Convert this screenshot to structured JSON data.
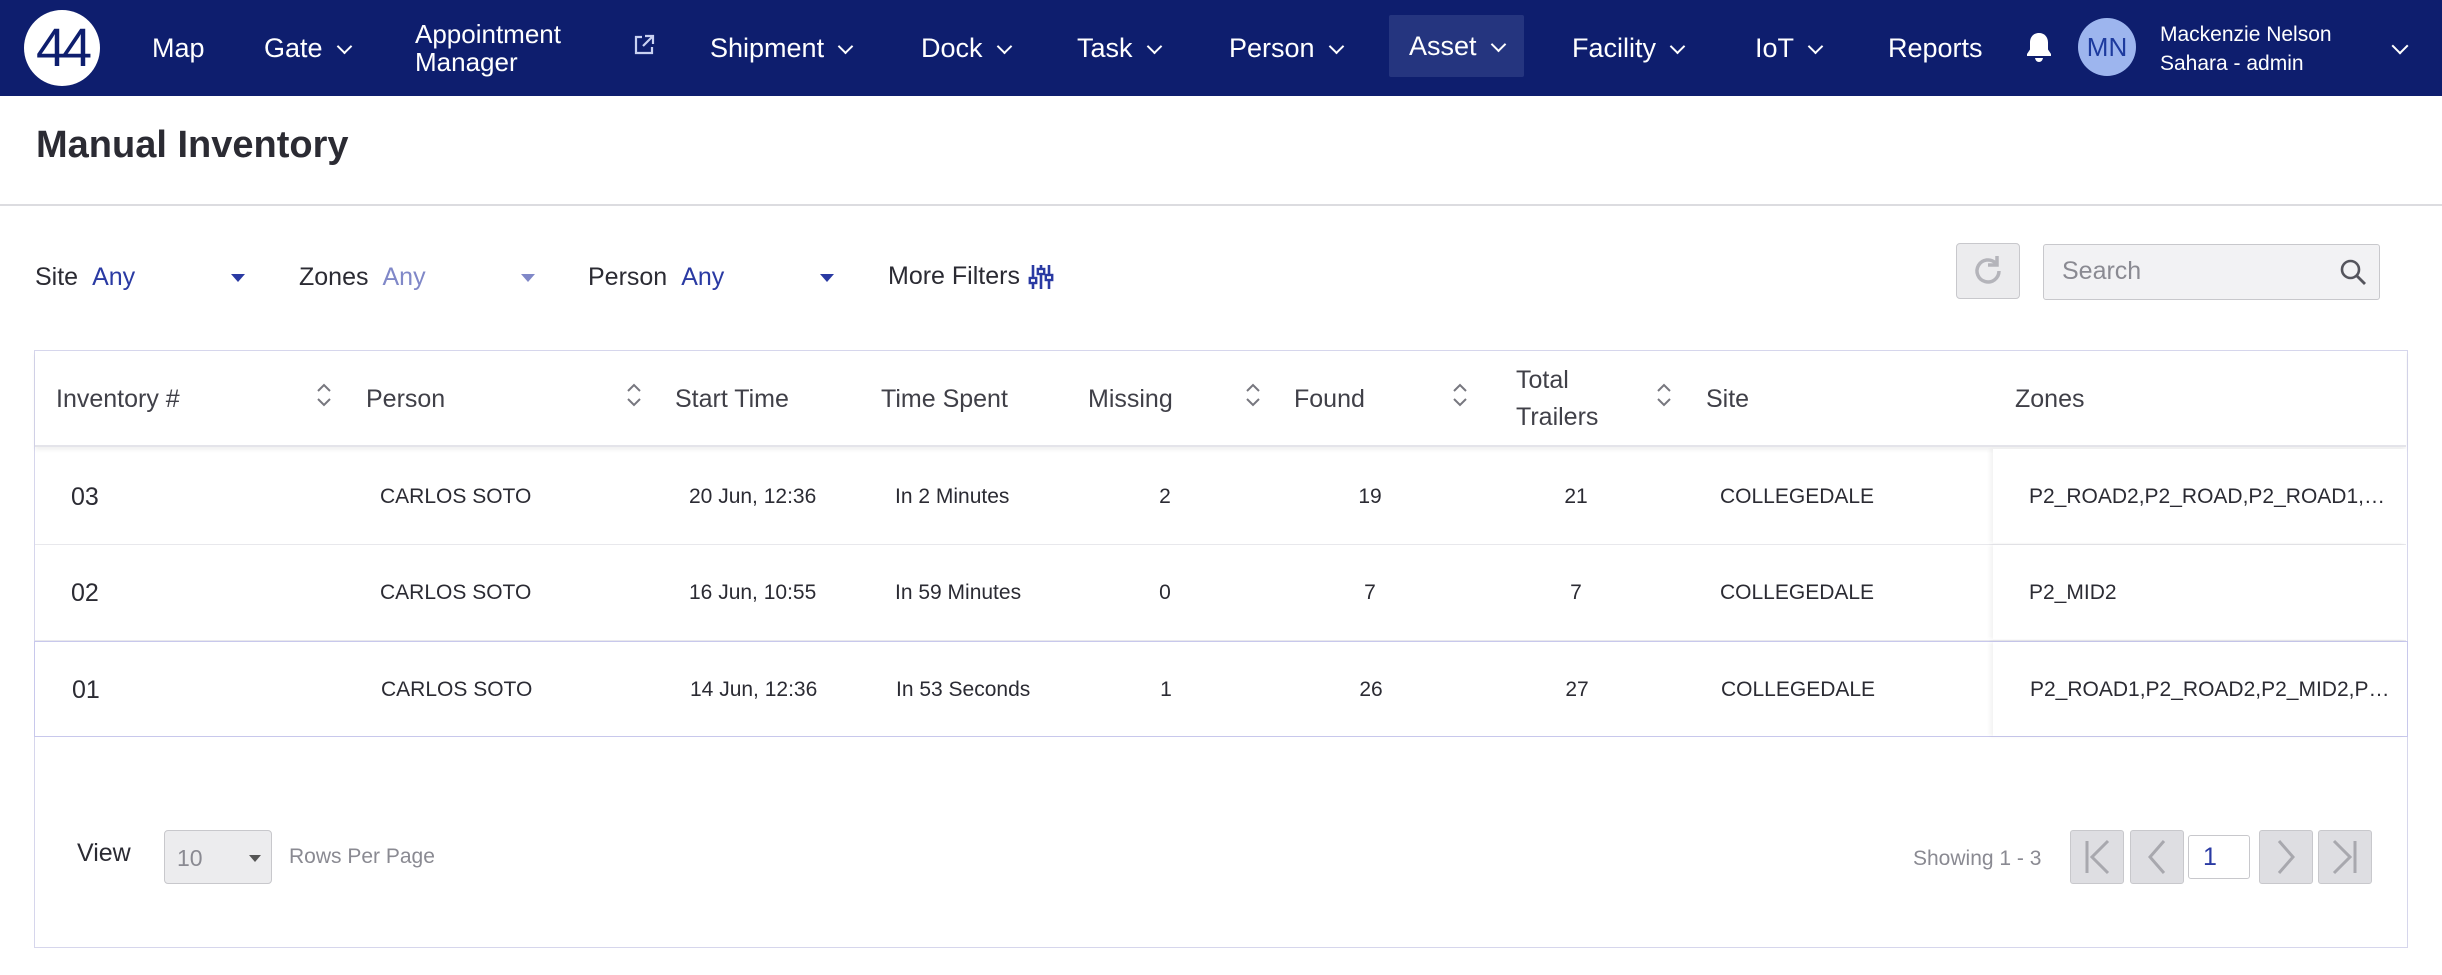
{
  "nav": {
    "logo_text": "44",
    "items": [
      {
        "label": "Map"
      },
      {
        "label": "Gate"
      },
      {
        "label_line1": "Appointment",
        "label_line2": "Manager"
      },
      {
        "label": "Shipment"
      },
      {
        "label": "Dock"
      },
      {
        "label": "Task"
      },
      {
        "label": "Person"
      },
      {
        "label": "Asset"
      },
      {
        "label": "Facility"
      },
      {
        "label": "IoT"
      },
      {
        "label": "Reports"
      }
    ],
    "active_item": "Asset",
    "user": {
      "initials": "MN",
      "name": "Mackenzie Nelson",
      "role": "Sahara - admin"
    }
  },
  "page": {
    "title": "Manual Inventory"
  },
  "filters": {
    "site": {
      "label": "Site",
      "value": "Any"
    },
    "zones": {
      "label": "Zones",
      "value": "Any"
    },
    "person": {
      "label": "Person",
      "value": "Any"
    },
    "more_filters_label": "More Filters",
    "search_placeholder": "Search"
  },
  "table": {
    "columns": {
      "inventory": "Inventory #",
      "person": "Person",
      "start_time": "Start Time",
      "time_spent": "Time Spent",
      "missing": "Missing",
      "found": "Found",
      "total_trailers_line1": "Total",
      "total_trailers_line2": "Trailers",
      "site": "Site",
      "zones": "Zones"
    },
    "rows": [
      {
        "id": "03",
        "person": "CARLOS SOTO",
        "start_time": "20 Jun, 12:36",
        "time_spent": "In 2 Minutes",
        "missing": "2",
        "found": "19",
        "total": "21",
        "site": "COLLEGEDALE",
        "zones": "P2_ROAD2,P2_ROAD,P2_ROAD1,P2..."
      },
      {
        "id": "02",
        "person": "CARLOS SOTO",
        "start_time": "16 Jun, 10:55",
        "time_spent": "In 59 Minutes",
        "missing": "0",
        "found": "7",
        "total": "7",
        "site": "COLLEGEDALE",
        "zones": "P2_MID2"
      },
      {
        "id": "01",
        "person": "CARLOS SOTO",
        "start_time": "14 Jun, 12:36",
        "time_spent": "In 53 Seconds",
        "missing": "1",
        "found": "26",
        "total": "27",
        "site": "COLLEGEDALE",
        "zones": "P2_ROAD1,P2_ROAD2,P2_MID2,P2..."
      }
    ]
  },
  "pagination": {
    "view_label": "View",
    "rows_per_page_value": "10",
    "rows_per_page_label": "Rows Per Page",
    "showing_text": "Showing 1 - 3",
    "current_page": "1"
  },
  "colors": {
    "nav_bg": "#0e1e6e",
    "accent": "#2a3aa3",
    "avatar_bg": "#9db5ee"
  }
}
